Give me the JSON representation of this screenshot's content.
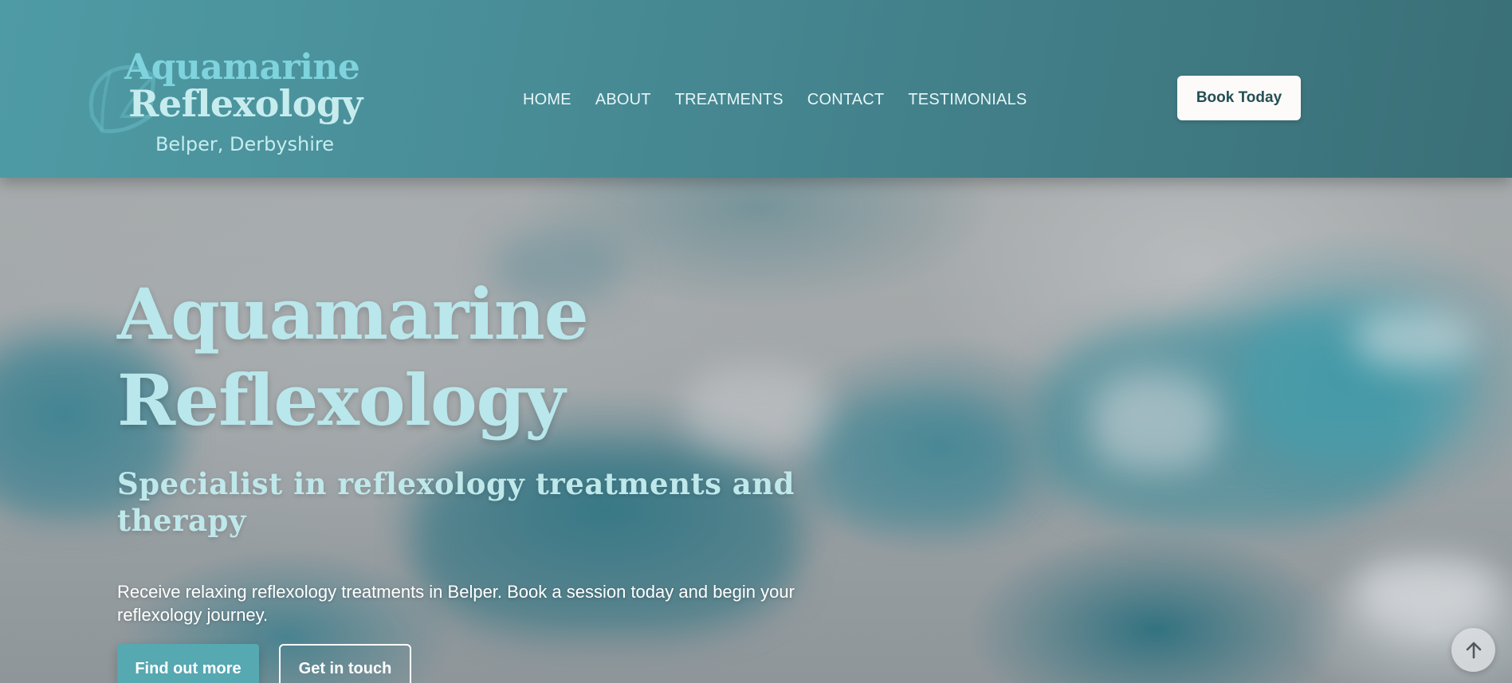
{
  "brand": {
    "line1": "Aquamarine",
    "line2": "Reflexology",
    "tagline": "Belper, Derbyshire",
    "logo_icon": "aquamarine-gem-icon"
  },
  "nav": {
    "items": [
      {
        "label": "HOME"
      },
      {
        "label": "ABOUT"
      },
      {
        "label": "TREATMENTS"
      },
      {
        "label": "CONTACT"
      },
      {
        "label": "TESTIMONIALS"
      }
    ],
    "cta_label": "Book Today"
  },
  "hero": {
    "title_line1": "Aquamarine",
    "title_line2": "Reflexology",
    "subtitle": "Specialist in reflexology treatments and therapy",
    "description": "Receive relaxing reflexology treatments in Belper. Book a session today and begin your reflexology journey.",
    "primary_button": "Find out more",
    "secondary_button": "Get in touch"
  },
  "scroll_top": {
    "icon": "arrow-up-icon"
  },
  "colors": {
    "header_start": "#4f9ba5",
    "header_end": "#3a6f77",
    "accent": "#56a8b1",
    "title_color": "#b9e7eb",
    "logo_accent": "#7ed3dc"
  }
}
